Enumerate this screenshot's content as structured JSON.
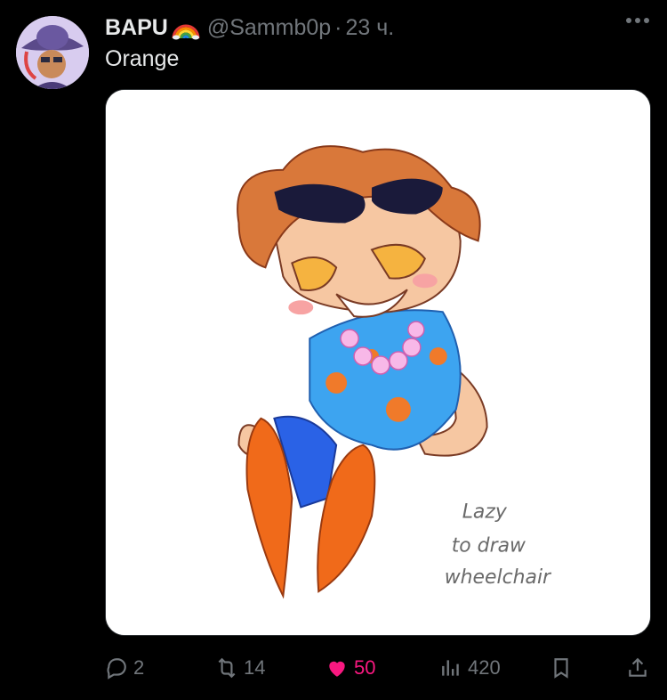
{
  "author": {
    "display_name": "BAPU",
    "badge_icon": "rainbow-emoji",
    "handle": "@Sammb0p",
    "separator": "·",
    "time": "23 ч."
  },
  "tweet": {
    "text": "Orange"
  },
  "media": {
    "handwritten_note": [
      "Lazy",
      "to draw",
      "wheelchair"
    ]
  },
  "actions": {
    "replies": "2",
    "reposts": "14",
    "likes": "50",
    "views": "420",
    "liked": true
  },
  "colors": {
    "background": "#000000",
    "text": "#e7e9ea",
    "muted": "#71767b",
    "like": "#f91880"
  }
}
